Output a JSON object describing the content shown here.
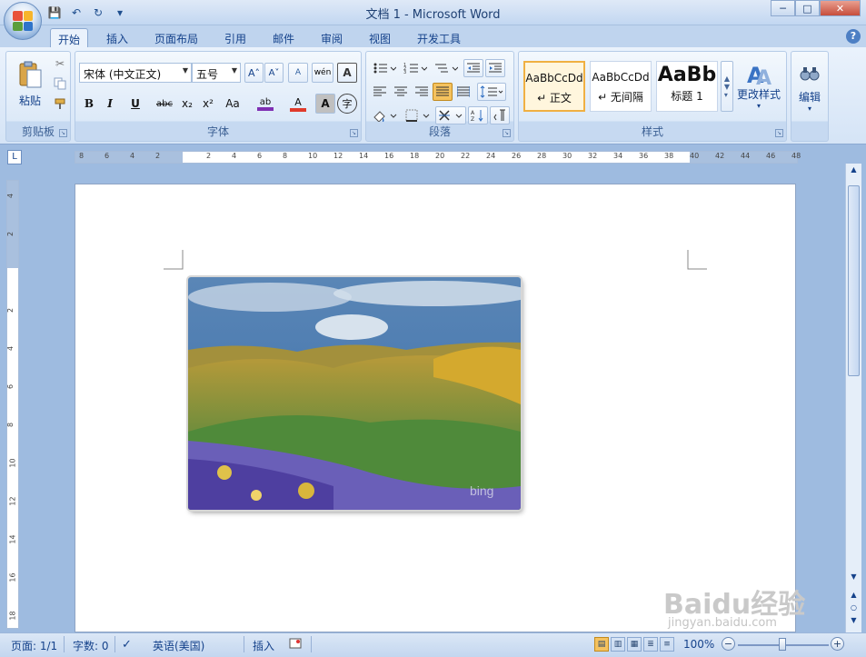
{
  "window": {
    "title": "文档 1 - Microsoft Word",
    "min": "─",
    "max": "□",
    "close": "✕"
  },
  "qat": {
    "save": "💾",
    "undo": "↶",
    "redo": "↻",
    "more": "▾"
  },
  "tabs": [
    "开始",
    "插入",
    "页面布局",
    "引用",
    "邮件",
    "审阅",
    "视图",
    "开发工具"
  ],
  "help": "?",
  "clipboard": {
    "paste": "粘贴",
    "label": "剪贴板"
  },
  "font": {
    "name": "宋体 (中文正文)",
    "size": "五号",
    "label": "字体",
    "grow": "A˄",
    "shrink": "A˅",
    "bold": "B",
    "italic": "I",
    "underline": "U",
    "strike": "abc",
    "sub": "x₂",
    "sup": "x²",
    "case": "Aa",
    "highlight": "ab",
    "color": "A",
    "shade": "A",
    "enclose": "字",
    "pinyin": "wén",
    "border": "A",
    "clear": "A"
  },
  "paragraph": {
    "label": "段落"
  },
  "styles": {
    "label": "样式",
    "items": [
      {
        "preview": "AaBbCcDd",
        "name": "↵ 正文"
      },
      {
        "preview": "AaBbCcDd",
        "name": "↵ 无间隔"
      },
      {
        "preview": "AaBb",
        "name": "标题 1"
      }
    ],
    "change": "更改样式"
  },
  "editing": {
    "label": "编辑"
  },
  "ruler": {
    "ticks": [
      "8",
      "6",
      "4",
      "2",
      "",
      "2",
      "4",
      "6",
      "8",
      "10",
      "12",
      "14",
      "16",
      "18",
      "20",
      "22",
      "24",
      "26",
      "28",
      "30",
      "32",
      "34",
      "36",
      "38",
      "40",
      "42",
      "44",
      "46",
      "48"
    ]
  },
  "vruler": {
    "ticks": [
      "4",
      "2",
      "",
      "2",
      "4",
      "6",
      "8",
      "10",
      "12",
      "14",
      "16",
      "18"
    ]
  },
  "status": {
    "page": "页面: 1/1",
    "words": "字数: 0",
    "language": "英语(美国)",
    "mode": "插入",
    "zoom": "100%"
  },
  "watermark": {
    "brand": "Baidu经验",
    "url": "jingyan.baidu.com"
  },
  "colors": {
    "accent": "#15428b",
    "highlight": "#f0b042"
  }
}
